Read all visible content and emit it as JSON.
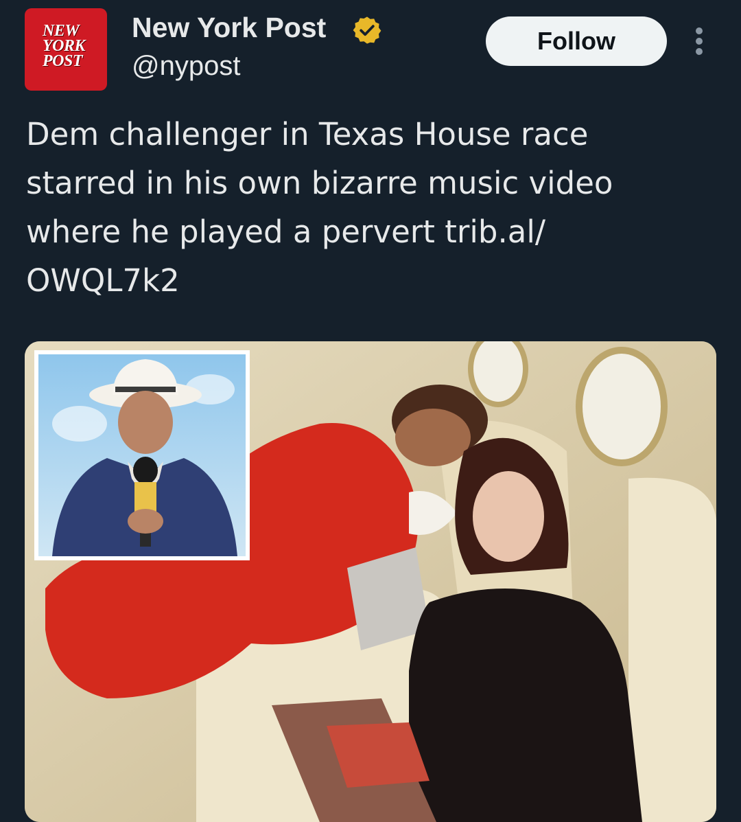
{
  "account": {
    "display_name": "New York Post",
    "handle": "@nypost",
    "verified_badge": "verified-gold-check-icon",
    "avatar_logo_lines": [
      "NEW",
      "YORK",
      "POST"
    ]
  },
  "actions": {
    "follow_label": "Follow",
    "more_icon": "more-vertical-icon"
  },
  "tweet": {
    "text": "Dem challenger in Texas House race\nstarred in his own bizarre music video\nwhere he played a pervert trib.al/\nOWQL7k2"
  },
  "media": {
    "type": "photo"
  },
  "colors": {
    "background": "#15202b",
    "text": "#e7e9ea",
    "follow_bg": "#eff3f4",
    "avatar_red": "#cf1a24",
    "badge_gold": "#e8b829"
  }
}
